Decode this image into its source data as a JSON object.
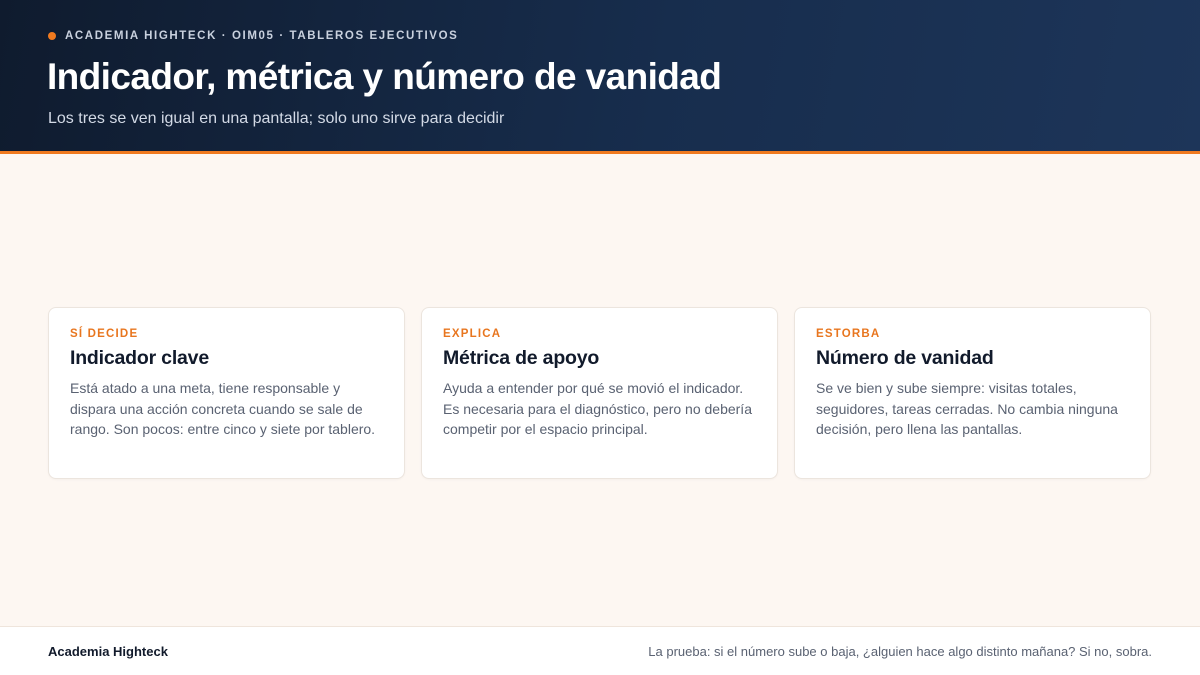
{
  "header": {
    "eyebrow": "ACADEMIA HIGHTECK · OIM05 · TABLEROS EJECUTIVOS",
    "title": "Indicador, métrica y número de vanidad",
    "subtitle": "Los tres se ven igual en una pantalla; solo uno sirve para decidir"
  },
  "cards": [
    {
      "tag": "SÍ DECIDE",
      "title": "Indicador clave",
      "body": "Está atado a una meta, tiene responsable y dispara una acción concreta cuando se sale de rango. Son pocos: entre cinco y siete por tablero."
    },
    {
      "tag": "EXPLICA",
      "title": "Métrica de apoyo",
      "body": "Ayuda a entender por qué se movió el indicador. Es necesaria para el diagnóstico, pero no debería competir por el espacio principal."
    },
    {
      "tag": "ESTORBA",
      "title": "Número de vanidad",
      "body": "Se ve bien y sube siempre: visitas totales, seguidores, tareas cerradas. No cambia ninguna decisión, pero llena las pantallas."
    }
  ],
  "footer": {
    "brand": "Academia Highteck",
    "note": "La prueba: si el número sube o baja, ¿alguien hace algo distinto mañana? Si no, sobra."
  },
  "colors": {
    "accent": "#f07a1f",
    "header_dark": "#0f1b2e",
    "header_light": "#1d3559",
    "background": "#fdf7f2"
  }
}
